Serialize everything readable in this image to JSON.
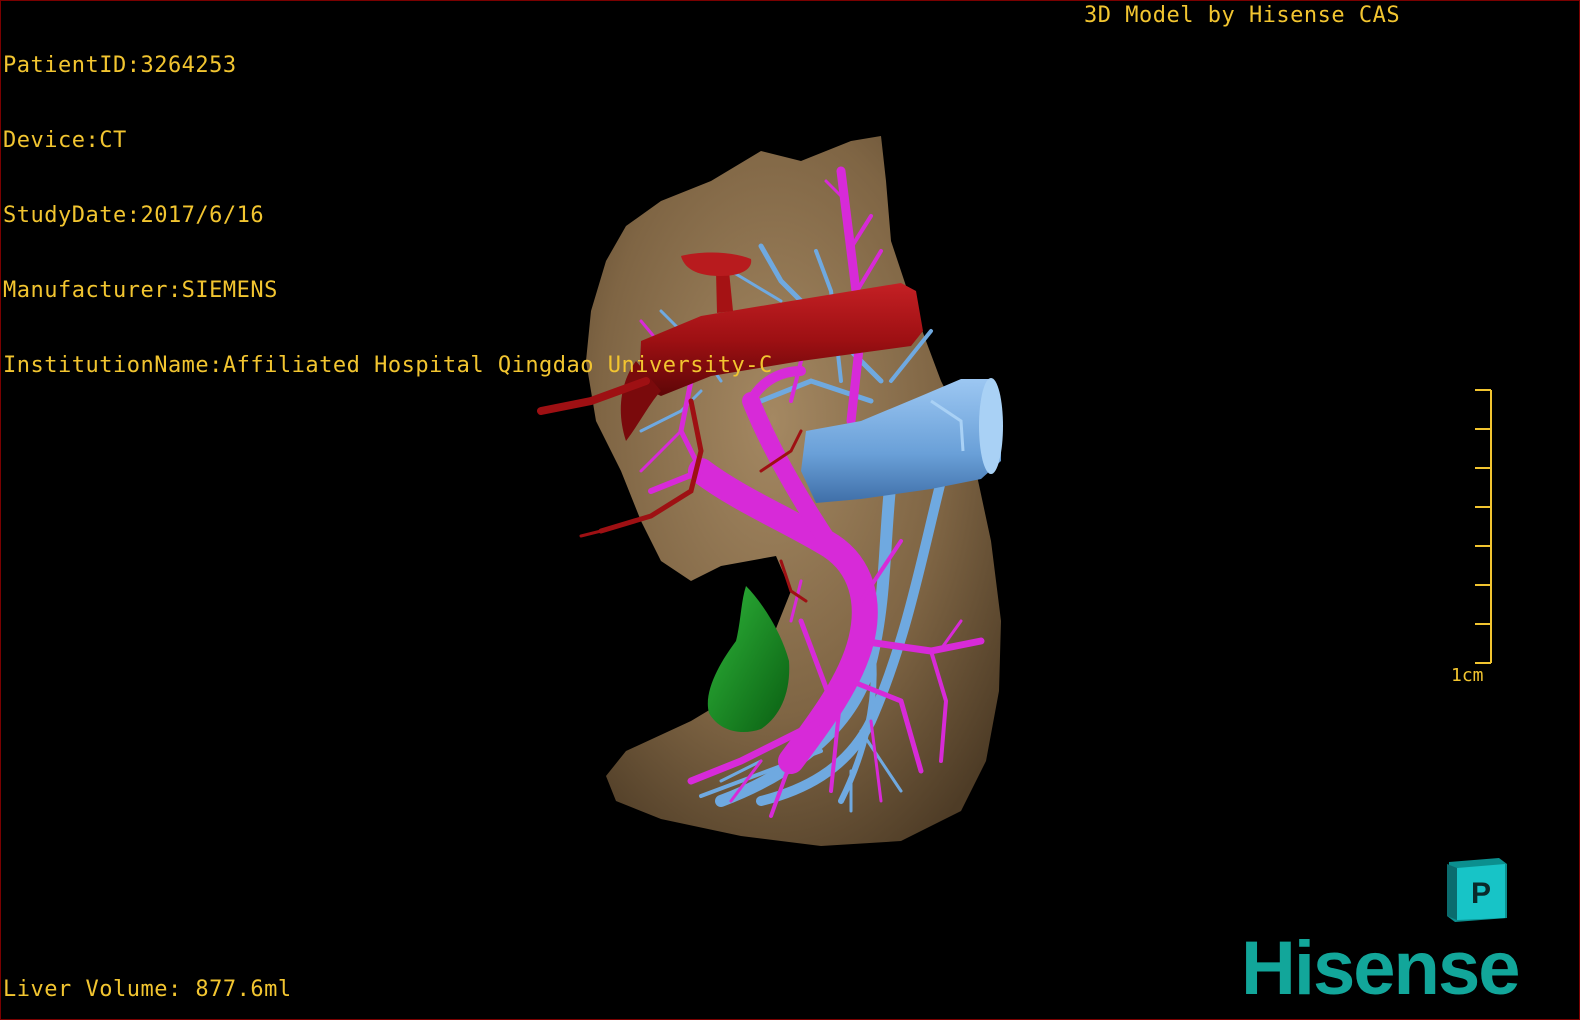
{
  "patient_info": {
    "patient_id": "PatientID:3264253",
    "device": "Device:CT",
    "study_date": "StudyDate:2017/6/16",
    "manufacturer": "Manufacturer:SIEMENS",
    "institution": "InstitutionName:Affiliated Hospital Qingdao University-C"
  },
  "model_credit": "3D Model by Hisense CAS",
  "liver_volume": "Liver Volume: 877.6ml",
  "scale": {
    "label": "1cm"
  },
  "orientation_cube": {
    "face_label": "P"
  },
  "brand": {
    "logo_text": "Hisense"
  },
  "colors": {
    "overlay_text": "#f2c530",
    "liver": "#8a6f4b",
    "hepatic_artery": "#a51214",
    "portal_vein": "#d72ad8",
    "hepatic_vein": "#6fa9e0",
    "gallbladder": "#138d1c",
    "brand": "#12a69a"
  }
}
